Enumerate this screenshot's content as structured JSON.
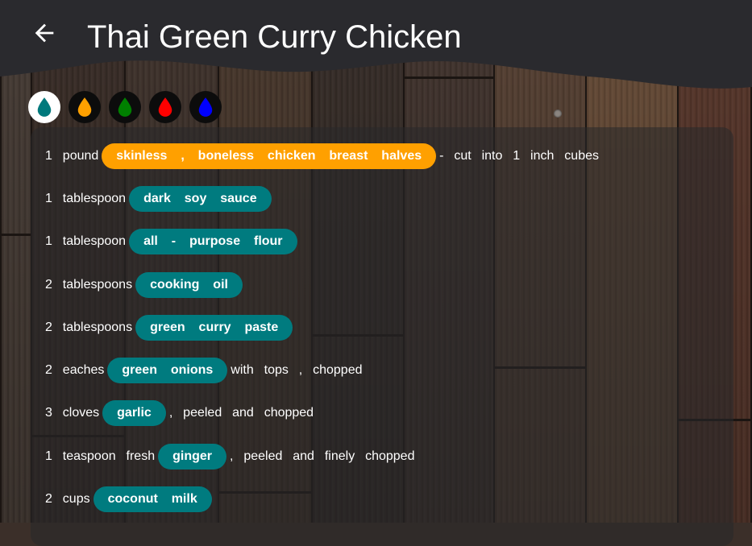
{
  "header": {
    "title": "Thai Green Curry Chicken"
  },
  "icons": {
    "back": "arrow-left-icon",
    "drop": "water-drop-icon"
  },
  "colors": {
    "header_bg": "#2a2a2e",
    "pill_default": "#007b7f",
    "pill_highlight": "#ffa000"
  },
  "color_picker": [
    {
      "color": "#00797c",
      "selected": true
    },
    {
      "color": "#ffa000",
      "selected": false
    },
    {
      "color": "#008000",
      "selected": false
    },
    {
      "color": "#ff0000",
      "selected": false
    },
    {
      "color": "#0000ff",
      "selected": false
    }
  ],
  "ingredients": [
    {
      "before": "1  pound",
      "item": "skinless  ,  boneless  chicken  breast  halves",
      "after": "-  cut  into  1  inch  cubes",
      "highlight": true
    },
    {
      "before": "1  tablespoon",
      "item": "dark  soy  sauce",
      "after": ""
    },
    {
      "before": "1  tablespoon",
      "item": "all  -  purpose  flour",
      "after": ""
    },
    {
      "before": "2  tablespoons",
      "item": "cooking  oil",
      "after": ""
    },
    {
      "before": "2  tablespoons",
      "item": "green  curry  paste",
      "after": ""
    },
    {
      "before": "2  eaches",
      "item": "green  onions",
      "after": "with  tops  ,  chopped"
    },
    {
      "before": "3  cloves",
      "item": "garlic",
      "after": ",  peeled  and  chopped"
    },
    {
      "before": "1  teaspoon  fresh",
      "item": "ginger",
      "after": ",  peeled  and  finely  chopped"
    },
    {
      "before": "2  cups",
      "item": "coconut  milk",
      "after": ""
    }
  ]
}
